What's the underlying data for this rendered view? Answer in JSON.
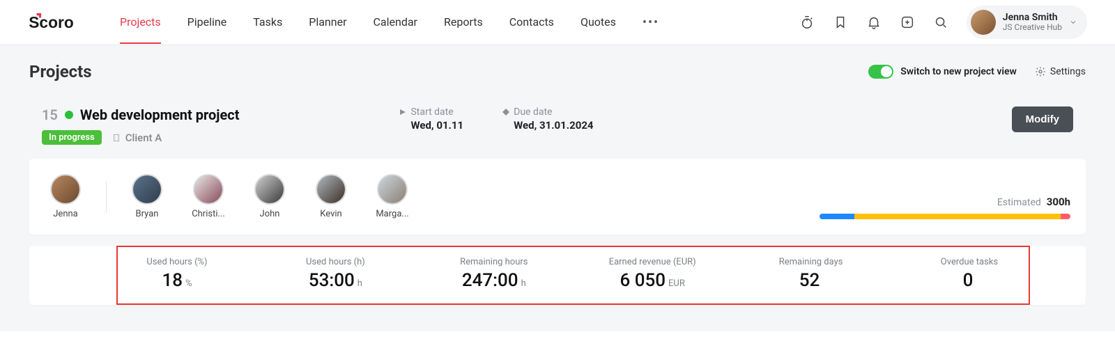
{
  "nav": {
    "items": [
      "Projects",
      "Pipeline",
      "Tasks",
      "Planner",
      "Calendar",
      "Reports",
      "Contacts",
      "Quotes"
    ],
    "active_index": 0
  },
  "user": {
    "name": "Jenna Smith",
    "org": "JS Creative Hub"
  },
  "page": {
    "title": "Projects",
    "switch_label": "Switch to new project view",
    "settings": "Settings"
  },
  "project": {
    "number": "15",
    "name": "Web development project",
    "status": "In progress",
    "client": "Client A",
    "start_label": "Start date",
    "start_value": "Wed, 01.11",
    "due_label": "Due date",
    "due_value": "Wed, 31.01.2024",
    "modify": "Modify"
  },
  "members": [
    {
      "name": "Jenna"
    },
    {
      "name": "Bryan"
    },
    {
      "name": "Christi..."
    },
    {
      "name": "John"
    },
    {
      "name": "Kevin"
    },
    {
      "name": "Marga..."
    }
  ],
  "progress": {
    "est_label": "Estimated",
    "est_value": "300h",
    "segments": {
      "blue_pct": 14,
      "yellow_pct": 82,
      "red_pct": 4
    }
  },
  "metrics": [
    {
      "label": "Used hours (%)",
      "value": "18",
      "unit": "%"
    },
    {
      "label": "Used hours (h)",
      "value": "53:00",
      "unit": "h"
    },
    {
      "label": "Remaining hours",
      "value": "247:00",
      "unit": "h"
    },
    {
      "label": "Earned revenue (EUR)",
      "value": "6 050",
      "unit": "EUR"
    },
    {
      "label": "Remaining days",
      "value": "52",
      "unit": ""
    },
    {
      "label": "Overdue tasks",
      "value": "0",
      "unit": ""
    }
  ],
  "colors": {
    "accent": "#e63946",
    "green": "#37c24a"
  }
}
